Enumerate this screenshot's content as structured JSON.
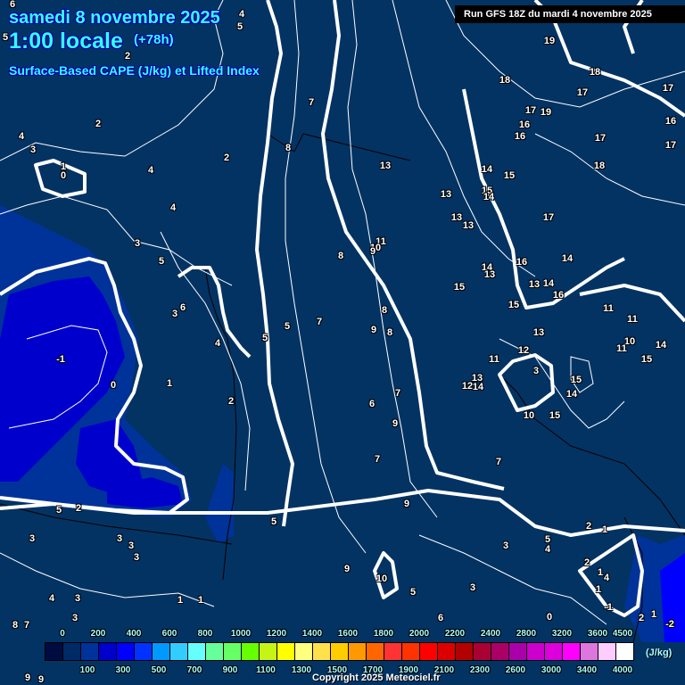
{
  "header": {
    "date": "samedi 8 novembre 2025",
    "time": "1:00 locale",
    "lead": "(+78h)",
    "subtitle": "Surface-Based CAPE (J/kg) et Lifted Index",
    "run": "Run GFS 18Z du mardi 4 novembre 2025"
  },
  "legend": {
    "unit": "(J/kg)",
    "colors": [
      "#000c40",
      "#002a66",
      "#003399",
      "#0000cc",
      "#0000ff",
      "#0033ff",
      "#0099ff",
      "#33ccff",
      "#66ffff",
      "#66ff99",
      "#66ff66",
      "#66ff00",
      "#c6f515",
      "#ffff00",
      "#ffff80",
      "#ffe14c",
      "#ffcc00",
      "#ff9900",
      "#ff6600",
      "#ff3333",
      "#ff3300",
      "#ff0000",
      "#dd0000",
      "#b30000",
      "#aa0033",
      "#aa0066",
      "#aa00aa",
      "#cc00cc",
      "#dd00dd",
      "#ff00ff",
      "#dd77dd",
      "#ffccff",
      "#ffffff"
    ],
    "top_ticks": [
      "0",
      "200",
      "400",
      "600",
      "800",
      "1000",
      "1200",
      "1400",
      "1600",
      "1800",
      "2000",
      "2200",
      "2400",
      "2800",
      "3200",
      "3600",
      "4500"
    ],
    "bottom_ticks": [
      "100",
      "300",
      "500",
      "700",
      "900",
      "1100",
      "1300",
      "1500",
      "1700",
      "1900",
      "2100",
      "2300",
      "2600",
      "3000",
      "3400",
      "4000"
    ]
  },
  "lifted_index_labels": [
    "6",
    "4",
    "5",
    "5",
    "19",
    "2",
    "7",
    "18",
    "18",
    "17",
    "17",
    "17",
    "19",
    "16",
    "4",
    "2",
    "3",
    "8",
    "16",
    "16",
    "17",
    "17",
    "2",
    "1",
    "0",
    "4",
    "13",
    "14",
    "15",
    "18",
    "13",
    "15",
    "14",
    "4",
    "13",
    "13",
    "17",
    "11",
    "10",
    "9",
    "3",
    "8",
    "5",
    "16",
    "14",
    "14",
    "13",
    "13",
    "14",
    "16",
    "15",
    "6",
    "3",
    "15",
    "11",
    "11",
    "8",
    "7",
    "5",
    "9",
    "8",
    "13",
    "10",
    "11",
    "14",
    "4",
    "5",
    "12",
    "15",
    "-1",
    "11",
    "3",
    "13",
    "0",
    "1",
    "15",
    "12",
    "14",
    "14",
    "7",
    "2",
    "6",
    "10",
    "15",
    "9",
    "7",
    "7",
    "9",
    "5",
    "2",
    "3",
    "3",
    "3",
    "3",
    "5",
    "2",
    "1",
    "5",
    "3",
    "4",
    "9",
    "2",
    "1",
    "4",
    "10",
    "4",
    "3",
    "1",
    "1",
    "5",
    "3",
    "1",
    "-1",
    "6",
    "0",
    "3",
    "2",
    "1",
    "-2",
    "8",
    "7",
    "9",
    "9"
  ],
  "copyright": "Copyright 2025 Meteociel.fr"
}
